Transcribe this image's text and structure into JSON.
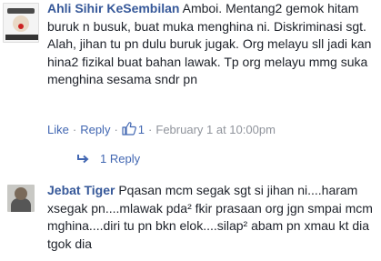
{
  "comment1": {
    "author": "Ahli Sihir KeSembilan",
    "text": "Amboi. Mentang2 gemok hitam buruk n busuk, buat muka menghina ni. Diskriminasi sgt. Alah, jihan tu pn dulu buruk jugak. Org melayu sll jadi kan hina2 fizikal buat bahan lawak. Tp org melayu mmg suka menghina sesama sndr pn",
    "actions": {
      "like_label": "Like",
      "reply_label": "Reply",
      "like_count": "1",
      "timestamp": "February 1 at 10:00pm"
    },
    "replies_label": "1 Reply",
    "avatar_icon": "profile-avatar-icon"
  },
  "comment2": {
    "author": "Jebat Tiger",
    "text": "Pqasan mcm segak sgt si jihan ni....haram xsegak pn....mlawak pda² fkir prasaan org jgn smpai mcm mghina....diri tu pn bkn elok....silap² abam pn xmau kt dia tgok dia",
    "avatar_icon": "profile-avatar-icon"
  },
  "colors": {
    "link": "#4267b2",
    "author": "#365899",
    "meta": "#90949c",
    "text": "#1d2129"
  }
}
